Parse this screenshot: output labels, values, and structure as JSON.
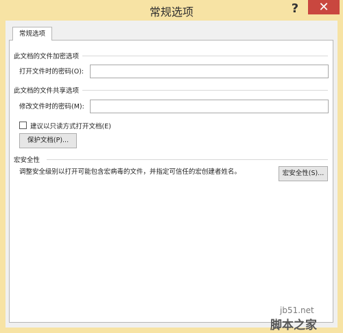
{
  "window": {
    "title": "常规选项",
    "help_glyph": "?",
    "close_glyph": "✕"
  },
  "tab": {
    "label": "常规选项"
  },
  "encryption": {
    "heading": "此文档的文件加密选项",
    "open_password_label": "打开文件时的密码",
    "open_password_mnemonic": "(O):",
    "open_password_value": ""
  },
  "sharing": {
    "heading": "此文档的文件共享选项",
    "modify_password_label": "修改文件时的密码",
    "modify_password_mnemonic": "(M):",
    "modify_password_value": "",
    "readonly_label": "建议以只读方式打开文档(E)",
    "readonly_checked": false,
    "protect_button": "保护文档(P)..."
  },
  "macro": {
    "heading": "宏安全性",
    "description": "调整安全级别以打开可能包含宏病毒的文件，并指定可信任的宏创建者姓名。",
    "button": "宏安全性(S)..."
  },
  "watermark": {
    "site": "jb51.net",
    "brand": "脚本之家"
  }
}
